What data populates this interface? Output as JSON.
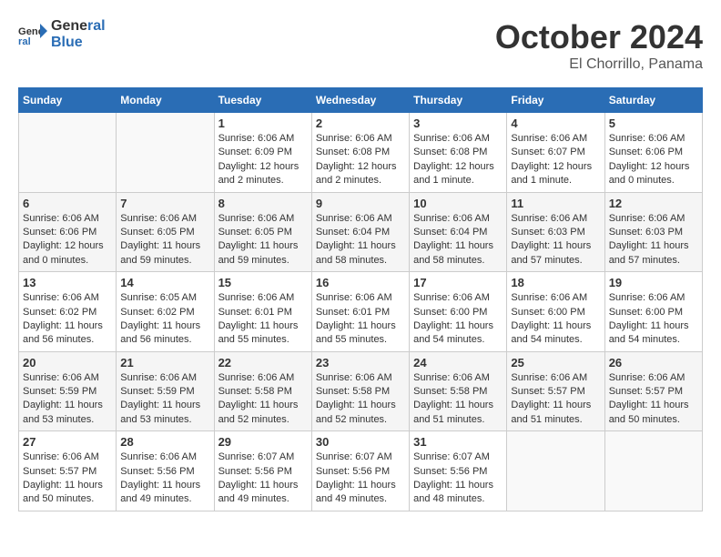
{
  "logo": {
    "line1": "General",
    "line2": "Blue"
  },
  "title": "October 2024",
  "location": "El Chorrillo, Panama",
  "days_of_week": [
    "Sunday",
    "Monday",
    "Tuesday",
    "Wednesday",
    "Thursday",
    "Friday",
    "Saturday"
  ],
  "weeks": [
    [
      {
        "day": "",
        "info": ""
      },
      {
        "day": "",
        "info": ""
      },
      {
        "day": "1",
        "info": "Sunrise: 6:06 AM\nSunset: 6:09 PM\nDaylight: 12 hours\nand 2 minutes."
      },
      {
        "day": "2",
        "info": "Sunrise: 6:06 AM\nSunset: 6:08 PM\nDaylight: 12 hours\nand 2 minutes."
      },
      {
        "day": "3",
        "info": "Sunrise: 6:06 AM\nSunset: 6:08 PM\nDaylight: 12 hours\nand 1 minute."
      },
      {
        "day": "4",
        "info": "Sunrise: 6:06 AM\nSunset: 6:07 PM\nDaylight: 12 hours\nand 1 minute."
      },
      {
        "day": "5",
        "info": "Sunrise: 6:06 AM\nSunset: 6:06 PM\nDaylight: 12 hours\nand 0 minutes."
      }
    ],
    [
      {
        "day": "6",
        "info": "Sunrise: 6:06 AM\nSunset: 6:06 PM\nDaylight: 12 hours\nand 0 minutes."
      },
      {
        "day": "7",
        "info": "Sunrise: 6:06 AM\nSunset: 6:05 PM\nDaylight: 11 hours\nand 59 minutes."
      },
      {
        "day": "8",
        "info": "Sunrise: 6:06 AM\nSunset: 6:05 PM\nDaylight: 11 hours\nand 59 minutes."
      },
      {
        "day": "9",
        "info": "Sunrise: 6:06 AM\nSunset: 6:04 PM\nDaylight: 11 hours\nand 58 minutes."
      },
      {
        "day": "10",
        "info": "Sunrise: 6:06 AM\nSunset: 6:04 PM\nDaylight: 11 hours\nand 58 minutes."
      },
      {
        "day": "11",
        "info": "Sunrise: 6:06 AM\nSunset: 6:03 PM\nDaylight: 11 hours\nand 57 minutes."
      },
      {
        "day": "12",
        "info": "Sunrise: 6:06 AM\nSunset: 6:03 PM\nDaylight: 11 hours\nand 57 minutes."
      }
    ],
    [
      {
        "day": "13",
        "info": "Sunrise: 6:06 AM\nSunset: 6:02 PM\nDaylight: 11 hours\nand 56 minutes."
      },
      {
        "day": "14",
        "info": "Sunrise: 6:05 AM\nSunset: 6:02 PM\nDaylight: 11 hours\nand 56 minutes."
      },
      {
        "day": "15",
        "info": "Sunrise: 6:06 AM\nSunset: 6:01 PM\nDaylight: 11 hours\nand 55 minutes."
      },
      {
        "day": "16",
        "info": "Sunrise: 6:06 AM\nSunset: 6:01 PM\nDaylight: 11 hours\nand 55 minutes."
      },
      {
        "day": "17",
        "info": "Sunrise: 6:06 AM\nSunset: 6:00 PM\nDaylight: 11 hours\nand 54 minutes."
      },
      {
        "day": "18",
        "info": "Sunrise: 6:06 AM\nSunset: 6:00 PM\nDaylight: 11 hours\nand 54 minutes."
      },
      {
        "day": "19",
        "info": "Sunrise: 6:06 AM\nSunset: 6:00 PM\nDaylight: 11 hours\nand 54 minutes."
      }
    ],
    [
      {
        "day": "20",
        "info": "Sunrise: 6:06 AM\nSunset: 5:59 PM\nDaylight: 11 hours\nand 53 minutes."
      },
      {
        "day": "21",
        "info": "Sunrise: 6:06 AM\nSunset: 5:59 PM\nDaylight: 11 hours\nand 53 minutes."
      },
      {
        "day": "22",
        "info": "Sunrise: 6:06 AM\nSunset: 5:58 PM\nDaylight: 11 hours\nand 52 minutes."
      },
      {
        "day": "23",
        "info": "Sunrise: 6:06 AM\nSunset: 5:58 PM\nDaylight: 11 hours\nand 52 minutes."
      },
      {
        "day": "24",
        "info": "Sunrise: 6:06 AM\nSunset: 5:58 PM\nDaylight: 11 hours\nand 51 minutes."
      },
      {
        "day": "25",
        "info": "Sunrise: 6:06 AM\nSunset: 5:57 PM\nDaylight: 11 hours\nand 51 minutes."
      },
      {
        "day": "26",
        "info": "Sunrise: 6:06 AM\nSunset: 5:57 PM\nDaylight: 11 hours\nand 50 minutes."
      }
    ],
    [
      {
        "day": "27",
        "info": "Sunrise: 6:06 AM\nSunset: 5:57 PM\nDaylight: 11 hours\nand 50 minutes."
      },
      {
        "day": "28",
        "info": "Sunrise: 6:06 AM\nSunset: 5:56 PM\nDaylight: 11 hours\nand 49 minutes."
      },
      {
        "day": "29",
        "info": "Sunrise: 6:07 AM\nSunset: 5:56 PM\nDaylight: 11 hours\nand 49 minutes."
      },
      {
        "day": "30",
        "info": "Sunrise: 6:07 AM\nSunset: 5:56 PM\nDaylight: 11 hours\nand 49 minutes."
      },
      {
        "day": "31",
        "info": "Sunrise: 6:07 AM\nSunset: 5:56 PM\nDaylight: 11 hours\nand 48 minutes."
      },
      {
        "day": "",
        "info": ""
      },
      {
        "day": "",
        "info": ""
      }
    ]
  ]
}
